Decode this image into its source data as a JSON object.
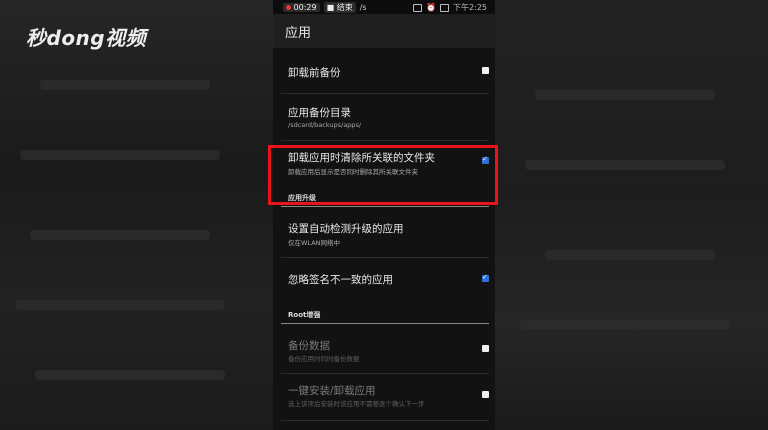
{
  "watermark": {
    "text": "秒dong视频"
  },
  "statusbar": {
    "rec_time": "00:29",
    "end_label": "结束",
    "clock": "下午2:25",
    "left_fragment": "/s"
  },
  "appbar": {
    "title": "应用"
  },
  "settings": [
    {
      "title": "卸载前备份",
      "subtitle": "",
      "checkbox": "unchecked"
    },
    {
      "title": "应用备份目录",
      "subtitle": "/sdcard/backups/apps/",
      "checkbox": null
    },
    {
      "title": "卸载应用时清除所关联的文件夹",
      "subtitle": "卸载应用后显示是否同时删除其所关联文件夹",
      "checkbox": "checked"
    }
  ],
  "section_upgrade": {
    "header": "应用升级",
    "items": [
      {
        "title": "设置自动检测升级的应用",
        "subtitle": "仅在WLAN网络中",
        "checkbox": null
      },
      {
        "title": "忽略签名不一致的应用",
        "subtitle": "",
        "checkbox": "checked"
      }
    ]
  },
  "section_root": {
    "header": "Root增强",
    "items": [
      {
        "title": "备份数据",
        "subtitle": "备份应用时同时备份数据",
        "checkbox": "unchecked",
        "disabled": true
      },
      {
        "title": "一键安装/卸载应用",
        "subtitle": "选上该项后安装时该应用不需要逐个确认下一步",
        "checkbox": "unchecked",
        "disabled": true
      }
    ]
  },
  "colors": {
    "highlight_box": "#e8141c",
    "checkbox_checked": "#2f6fd6",
    "background": "#121212"
  }
}
